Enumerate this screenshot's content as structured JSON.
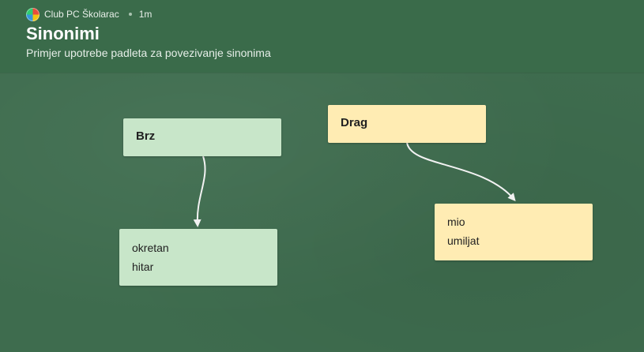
{
  "header": {
    "author": "Club PC Školarac",
    "time": "1m",
    "title": "Sinonimi",
    "subtitle": "Primjer upotrebe padleta za povezivanje sinonima"
  },
  "cards": {
    "brz": {
      "title": "Brz"
    },
    "brz_syn": {
      "lines": [
        "okretan",
        "hitar"
      ]
    },
    "drag": {
      "title": "Drag"
    },
    "drag_syn": {
      "lines": [
        "mio",
        "umiljat"
      ]
    }
  },
  "colors": {
    "board": "#3e6c4e",
    "header": "#3a6b4a",
    "green_card": "#c8e6c9",
    "yellow_card": "#ffecb3"
  }
}
